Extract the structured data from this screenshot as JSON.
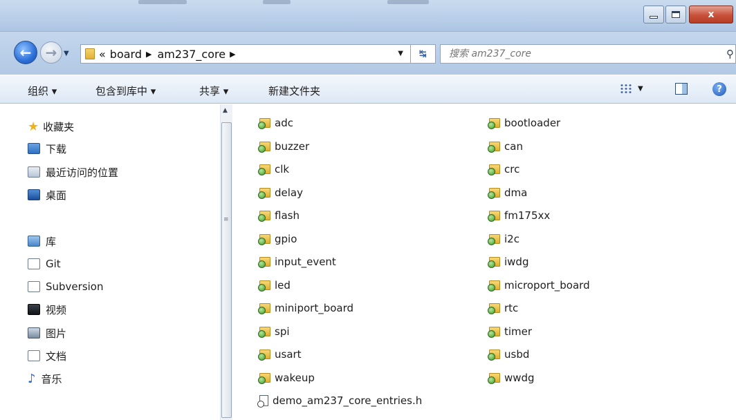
{
  "window": {
    "minimize_label": "",
    "maximize_label": "",
    "close_label": "x"
  },
  "address": {
    "overflow": "«",
    "crumbs": [
      "board",
      "am237_core"
    ],
    "search_placeholder": "搜索 am237_core"
  },
  "toolbar": {
    "organize": "组织 ▾",
    "include_library": "包含到库中 ▾",
    "share": "共享 ▾",
    "new_folder": "新建文件夹"
  },
  "nav": {
    "favorites": "收藏夹",
    "downloads": "下载",
    "recent": "最近访问的位置",
    "desktop": "桌面",
    "libraries": "库",
    "git": "Git",
    "subversion": "Subversion",
    "videos": "视频",
    "pictures": "图片",
    "documents": "文档",
    "music": "音乐"
  },
  "files": {
    "col1": [
      "adc",
      "buzzer",
      "clk",
      "delay",
      "flash",
      "gpio",
      "input_event",
      "led",
      "miniport_board",
      "spi",
      "usart",
      "wakeup"
    ],
    "col2": [
      "bootloader",
      "can",
      "crc",
      "dma",
      "fm175xx",
      "i2c",
      "iwdg",
      "microport_board",
      "rtc",
      "timer",
      "usbd",
      "wwdg"
    ],
    "header_file": "demo_am237_core_entries.h"
  },
  "icons": {
    "back": "back-arrow-icon",
    "forward": "forward-arrow-icon",
    "refresh": "refresh-icon",
    "search": "search-icon",
    "help": "help-icon"
  }
}
